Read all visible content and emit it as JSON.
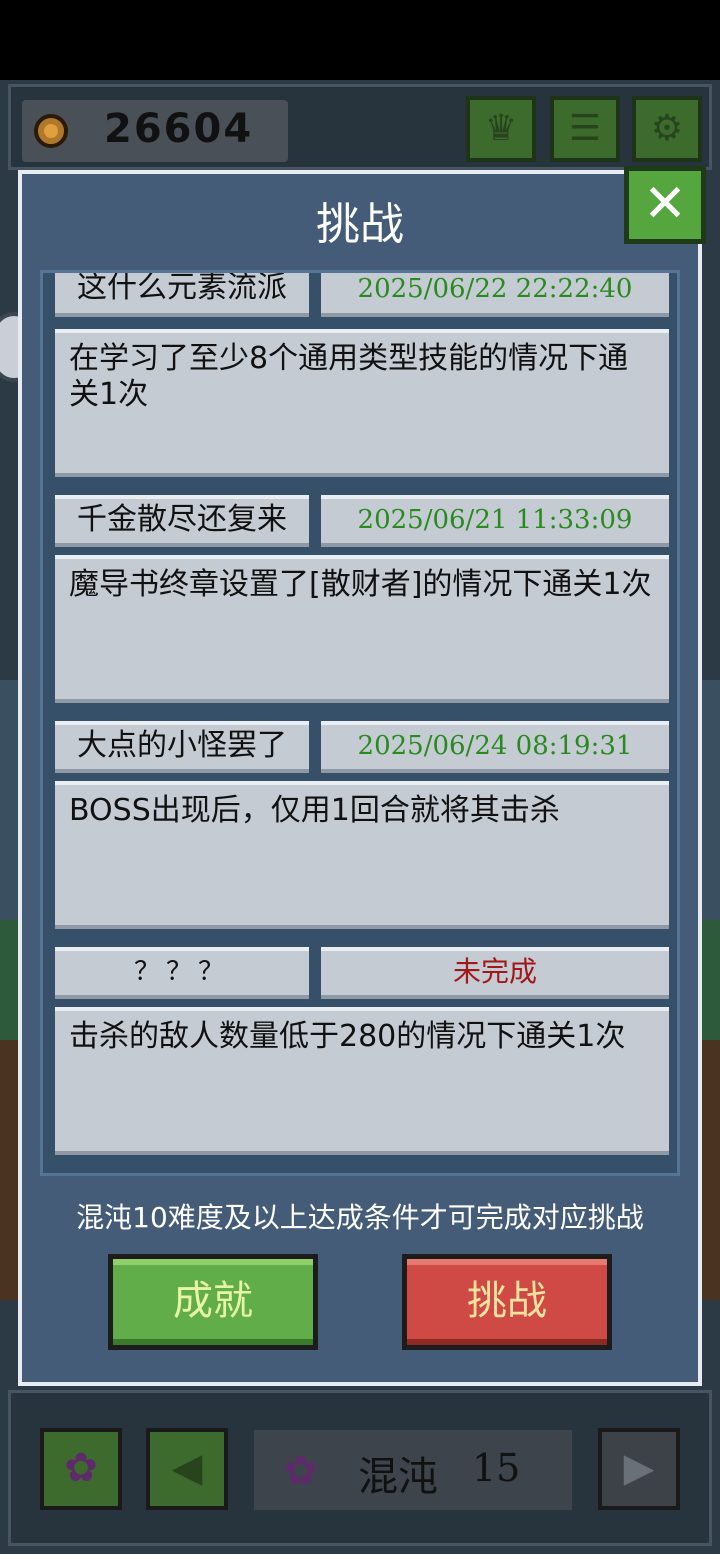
{
  "top_bar": {
    "coins": "26604",
    "icons": [
      "coin-icon",
      "trophy-icon",
      "list-icon",
      "gear-icon"
    ]
  },
  "modal": {
    "title": "挑战",
    "close_icon": "close-icon",
    "challenges": [
      {
        "name": "这什么元素流派",
        "date": "2025/06/22 22:22:40",
        "description": "在学习了至少8个通用类型技能的情况下通关1次",
        "completed": true
      },
      {
        "name": "千金散尽还复来",
        "date": "2025/06/21 11:33:09",
        "description": "魔导书终章设置了[散财者]的情况下通关1次",
        "completed": true
      },
      {
        "name": "大点的小怪罢了",
        "date": "2025/06/24 08:19:31",
        "description": "BOSS出现后，仅用1回合就将其击杀",
        "completed": true
      },
      {
        "name": "？？？",
        "status": "未完成",
        "description": "击杀的敌人数量低于280的情况下通关1次",
        "completed": false
      }
    ],
    "footer_note": "混沌10难度及以上达成条件才可完成对应挑战",
    "achievement_button": "成就",
    "challenge_button": "挑战"
  },
  "bottom_bar": {
    "difficulty_label": "混沌",
    "difficulty_level": "15"
  },
  "colors": {
    "modal_bg": "#445c78",
    "date_green": "#2a8a20",
    "incomplete_red": "#a01818",
    "achievement_green": "#61ad49",
    "challenge_red": "#cf4a44"
  }
}
